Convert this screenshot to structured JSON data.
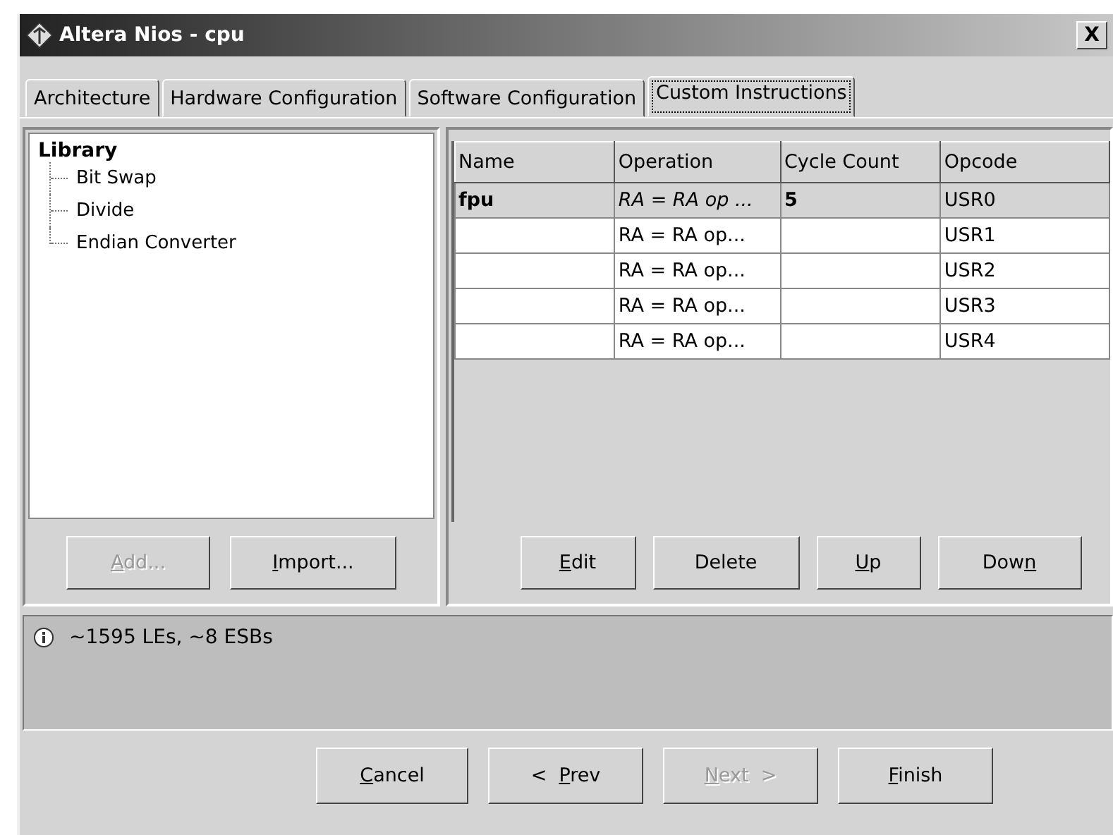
{
  "window": {
    "title": "Altera Nios - cpu",
    "close": "X"
  },
  "tabs": [
    {
      "label": "Architecture",
      "selected": false
    },
    {
      "label": "Hardware Configuration",
      "selected": false
    },
    {
      "label": "Software Configuration",
      "selected": false
    },
    {
      "label": "Custom Instructions",
      "selected": true
    }
  ],
  "library": {
    "title": "Library",
    "items": [
      "Bit Swap",
      "Divide",
      "Endian Converter"
    ]
  },
  "library_buttons": [
    {
      "key": "A",
      "post": "dd...",
      "disabled": true
    },
    {
      "key": "I",
      "post": "mport...",
      "disabled": false
    }
  ],
  "table": {
    "columns": [
      "Name",
      "Operation",
      "Cycle Count",
      "Opcode"
    ],
    "rows": [
      {
        "cells": [
          "fpu",
          "RA = RA op ...",
          "5",
          "USR0"
        ],
        "selected": true
      },
      {
        "cells": [
          "",
          "RA = RA op...",
          "",
          "USR1"
        ],
        "selected": false
      },
      {
        "cells": [
          "",
          "RA = RA op...",
          "",
          "USR2"
        ],
        "selected": false
      },
      {
        "cells": [
          "",
          "RA = RA op...",
          "",
          "USR3"
        ],
        "selected": false
      },
      {
        "cells": [
          "",
          "RA = RA op...",
          "",
          "USR4"
        ],
        "selected": false
      }
    ]
  },
  "table_buttons": [
    {
      "key": "E",
      "post": "dit",
      "disabled": false
    },
    {
      "pre": "Delete",
      "disabled": false
    },
    {
      "key": "U",
      "post": "p",
      "disabled": false
    },
    {
      "pre": "Dow",
      "key": "n",
      "disabled": false
    }
  ],
  "info": {
    "message": "~1595 LEs, ~8 ESBs"
  },
  "dialog_buttons": [
    {
      "key": "C",
      "post": "ancel",
      "disabled": false
    },
    {
      "pre": "<  ",
      "key": "P",
      "post": "rev",
      "disabled": false
    },
    {
      "key": "N",
      "post": "ext  >",
      "disabled": true
    },
    {
      "key": "F",
      "post": "inish",
      "disabled": false
    }
  ]
}
